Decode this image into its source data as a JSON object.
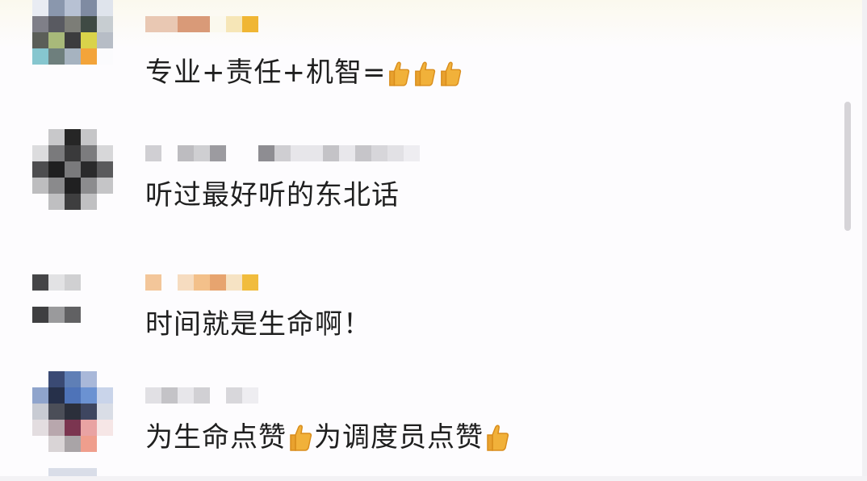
{
  "comments": [
    {
      "text": "专业+责任+机智=",
      "reactions": [
        "thumbs-up-icon",
        "thumbs-up-icon",
        "thumbs-up-icon"
      ]
    },
    {
      "text": "听过最好听的东北话"
    },
    {
      "text": "时间就是生命啊！"
    },
    {
      "text_part1": "为生命点赞",
      "text_part2": "为调度员点赞"
    }
  ],
  "colors": {
    "text": "#1f1f1f",
    "thumb": "#f1b13a",
    "thumb_outline": "#d98d1c",
    "scrollbar": "#d6d4d8"
  }
}
